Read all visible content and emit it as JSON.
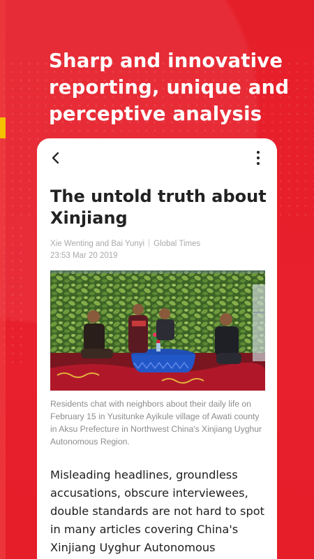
{
  "promo": {
    "headline": "Sharp and innovative reporting, unique and perceptive analysis"
  },
  "colors": {
    "background_red": "#e8202a",
    "accent_yellow": "#f4c000",
    "card_white": "#ffffff"
  },
  "article": {
    "title": "The untold truth about Xinjiang",
    "authors": "Xie Wenting and Bai Yunyi",
    "source": "Global Times",
    "timestamp": "23:53 Mar 20 2019",
    "image_icon": "photo-residents-chatting",
    "caption": "Residents chat with neighbors about their daily life on February 15 in Yusitunke Ayikule village of Awati county in Aksu Prefecture in Northwest China's Xinjiang Uyghur Autonomous Region.",
    "body": "Misleading headlines, groundless accusations, obscure interviewees, double standards are not hard to spot in many articles covering China's Xinjiang Uyghur Autonomous"
  },
  "toolbar": {
    "back_icon": "chevron-left-icon",
    "more_icon": "more-vertical-icon"
  }
}
